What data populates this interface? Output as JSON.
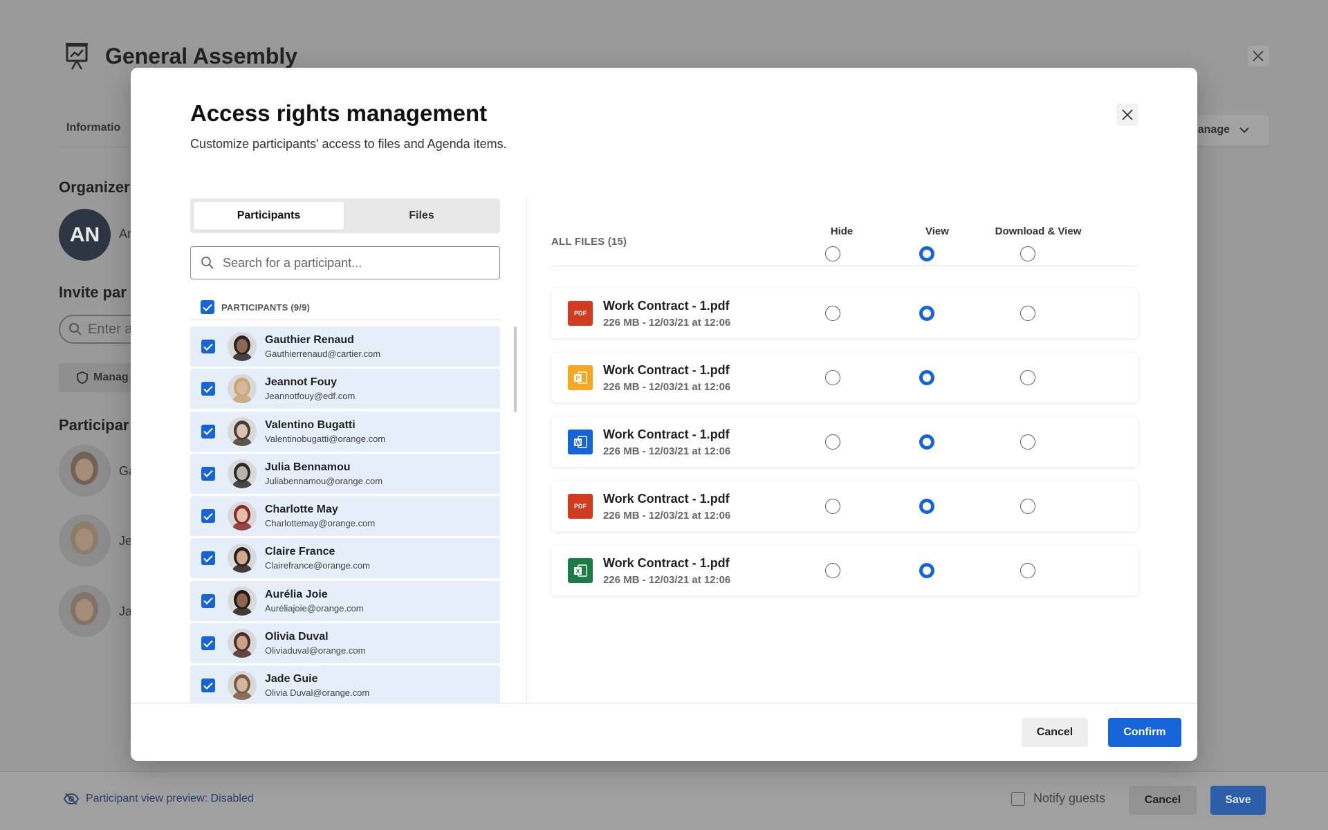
{
  "background": {
    "title": "General Assembly",
    "tab_information": "Informatio",
    "manage_label": "lanage",
    "organizer_section": "Organizer",
    "organizer_initials": "AN",
    "organizer_name_partial": "Ar",
    "invite_section": "Invite par",
    "invite_placeholder": "Enter a",
    "manage_button": "Manag",
    "participants_section": "Participar",
    "people": [
      {
        "name_partial": "Ga",
        "color": "#6b5848"
      },
      {
        "name_partial": "Je",
        "color": "#8a7a62"
      },
      {
        "name_partial": "Ja",
        "color": "#7d6d5e"
      }
    ],
    "footer": {
      "preview_text": "Participant view preview: Disabled",
      "notify_label": "Notify guests",
      "cancel_label": "Cancel",
      "save_label": "Save"
    }
  },
  "modal": {
    "title": "Access rights management",
    "subtitle": "Customize participants' access to files and Agenda items.",
    "tabs": [
      {
        "label": "Participants",
        "active": true
      },
      {
        "label": "Files",
        "active": false
      }
    ],
    "search_placeholder": "Search for a participant...",
    "participants_header": "PARTICIPANTS (9/9)",
    "participants": [
      {
        "name": "Gauthier Renaud",
        "email": "Gauthierrenaud@cartier.com",
        "checked": true,
        "skin": "#8b6a55",
        "hair": "#2a2522"
      },
      {
        "name": "Jeannot Fouy",
        "email": "Jeannotfouy@edf.com",
        "checked": true,
        "skin": "#d8b79c",
        "hair": "#c9a674"
      },
      {
        "name": "Valentino Bugatti",
        "email": "Valentinobugatti@orange.com",
        "checked": true,
        "skin": "#d7c2b3",
        "hair": "#4a3b33"
      },
      {
        "name": "Julia Bennamou",
        "email": "Juliabennamou@orange.com",
        "checked": true,
        "skin": "#b9b2ad",
        "hair": "#2b2b2b"
      },
      {
        "name": "Charlotte May",
        "email": "Charlottemay@orange.com",
        "checked": true,
        "skin": "#e1bfa8",
        "hair": "#8a2b2b"
      },
      {
        "name": "Claire France",
        "email": "Clairefrance@orange.com",
        "checked": true,
        "skin": "#cfa88e",
        "hair": "#2a201c"
      },
      {
        "name": "Aurélia Joie",
        "email": "Auréliajoie@orange.com",
        "checked": true,
        "skin": "#8f6552",
        "hair": "#241c18"
      },
      {
        "name": "Olivia Duval",
        "email": "Oliviaduval@orange.com",
        "checked": true,
        "skin": "#caa08a",
        "hair": "#4b2f28"
      },
      {
        "name": "Jade Guie",
        "email": "Olivia Duval@orange.com",
        "checked": true,
        "skin": "#d4b49d",
        "hair": "#7a5a44"
      }
    ],
    "files_header": "ALL FILES (15)",
    "columns": [
      "Hide",
      "View",
      "Download & View"
    ],
    "header_selection": "View",
    "files": [
      {
        "name": "Work Contract - 1.pdf",
        "meta": "226 MB - 12/03/21 at 12:06",
        "type": "pdf",
        "icon_label": "PDF",
        "icon_color": "#d13b1f",
        "access": "View"
      },
      {
        "name": "Work Contract - 1.pdf",
        "meta": "226 MB - 12/03/21 at 12:06",
        "type": "powerpoint",
        "icon_label": "P",
        "icon_color": "#f5a623",
        "access": "View"
      },
      {
        "name": "Work Contract - 1.pdf",
        "meta": "226 MB - 12/03/21 at 12:06",
        "type": "word",
        "icon_label": "W",
        "icon_color": "#1565d8",
        "access": "View"
      },
      {
        "name": "Work Contract - 1.pdf",
        "meta": "226 MB - 12/03/21 at 12:06",
        "type": "pdf",
        "icon_label": "PDF",
        "icon_color": "#d13b1f",
        "access": "View"
      },
      {
        "name": "Work Contract - 1.pdf",
        "meta": "226 MB - 12/03/21 at 12:06",
        "type": "excel",
        "icon_label": "X",
        "icon_color": "#1e7b45",
        "access": "View"
      }
    ],
    "cancel_label": "Cancel",
    "confirm_label": "Confirm",
    "accent_color": "#1565d8"
  }
}
